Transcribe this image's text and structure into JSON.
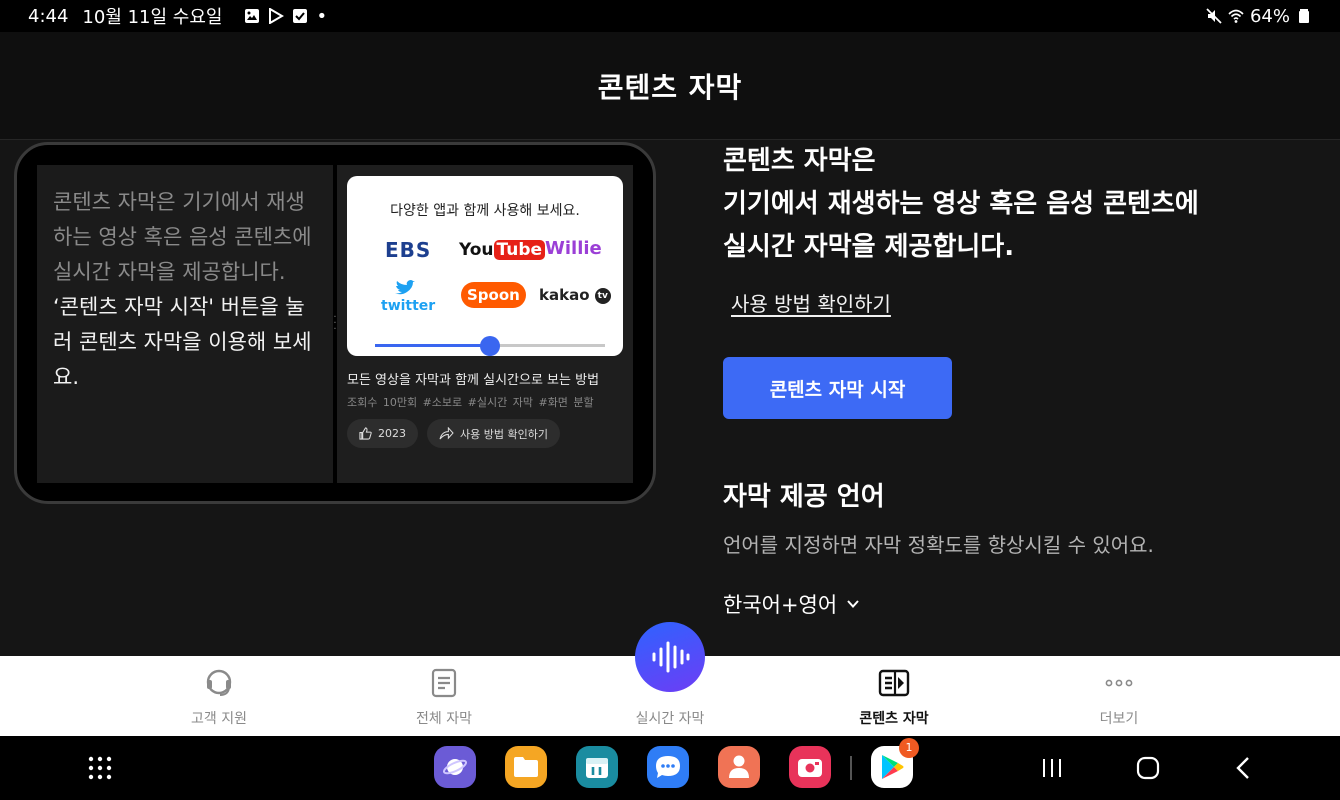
{
  "status_bar": {
    "time": "4:44",
    "date": "10월 11일 수요일",
    "notification_icons": [
      "gallery-icon",
      "play-store-icon",
      "checkbox-icon"
    ],
    "more_dot": "•",
    "battery": "64%"
  },
  "header": {
    "title": "콘텐츠 자막"
  },
  "illustration": {
    "left_text_gray": "콘텐츠 자막은 기기에서 재생하는 영상 혹은 음성 콘텐츠에 실시간 자막을 제공합니다.",
    "left_text_white": "‘콘텐츠 자막 시작' 버튼을 눌러 콘텐츠 자막을 이용해 보세요.",
    "card_title": "다양한 앱과 함께 사용해 보세요.",
    "logos": {
      "ebs": "EBS",
      "youtube_you": "You",
      "youtube_tube": "Tube",
      "willie": "Willie",
      "twitter": "twitter",
      "spoon": "Spoon",
      "kakao": "kakao",
      "kakao_tv": "tv"
    },
    "slider_level": 0.5,
    "video_title": "모든 영상을 자막과 함께 실시간으로 보는 방법",
    "video_meta": "조회수 10만회  #소보로 #실시간 자막 #화면 분할",
    "like_count": "2023",
    "share_label": "사용 방법 확인하기"
  },
  "main": {
    "headline_line1": "콘텐츠 자막은",
    "headline_line2": "기기에서 재생하는 영상 혹은 음성 콘텐츠에",
    "headline_line3": "실시간 자막을 제공합니다.",
    "guide_link": "사용 방법 확인하기",
    "start_button": "콘텐츠 자막 시작",
    "language_title": "자막 제공 언어",
    "language_desc": "언어를 지정하면 자막 정확도를 향상시킬 수 있어요.",
    "language_value": "한국어+영어"
  },
  "bottom_nav": {
    "items": [
      {
        "label": "고객 지원",
        "icon": "headset-icon"
      },
      {
        "label": "전체 자막",
        "icon": "document-icon"
      },
      {
        "label": "실시간 자막",
        "icon": "waveform-icon"
      },
      {
        "label": "콘텐츠 자막",
        "icon": "caption-play-icon",
        "active": true
      },
      {
        "label": "더보기",
        "icon": "more-icon"
      }
    ]
  },
  "dock": {
    "play_store_badge": "1",
    "colors": {
      "internet": "#6b5bd6",
      "files": "#f5a623",
      "calendar": "#1a8ca0",
      "messages": "#2f7df6",
      "contacts": "#f07355",
      "screen_recorder": "#e8335a",
      "accent": "#3d6af5"
    }
  }
}
